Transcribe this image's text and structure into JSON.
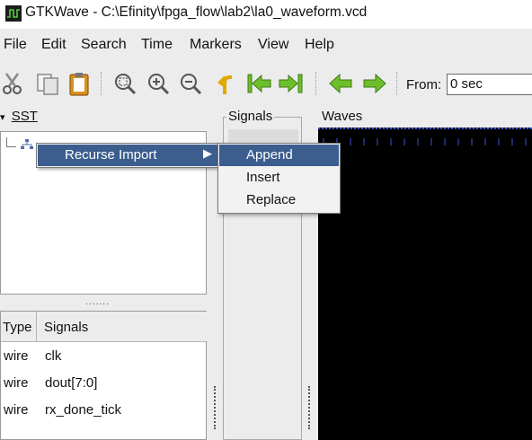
{
  "window": {
    "title": "GTKWave - C:\\Efinity\\fpga_flow\\lab2\\la0_waveform.vcd",
    "icon": "gtkwave-app-icon"
  },
  "menubar": {
    "items": [
      {
        "label": "File"
      },
      {
        "label": "Edit"
      },
      {
        "label": "Search"
      },
      {
        "label": "Time"
      },
      {
        "label": "Markers"
      },
      {
        "label": "View"
      },
      {
        "label": "Help"
      }
    ]
  },
  "toolbar": {
    "icons": [
      "cut-icon",
      "copy-icon",
      "paste-icon",
      "zoom-fit-icon",
      "zoom-in-icon",
      "zoom-out-icon",
      "undo-icon",
      "jump-to-start-icon",
      "jump-to-end-icon",
      "previous-edge-icon",
      "next-edge-icon"
    ],
    "from_label": "From:",
    "from_value": "0 sec"
  },
  "sst": {
    "title": "SST",
    "collapse_glyph": "▾",
    "handle": "......."
  },
  "signals_table": {
    "headers": {
      "type": "Type",
      "signals": "Signals"
    },
    "rows": [
      {
        "type": "wire",
        "name": "clk"
      },
      {
        "type": "wire",
        "name": "dout[7:0]"
      },
      {
        "type": "wire",
        "name": "rx_done_tick"
      }
    ]
  },
  "signals_frame": {
    "title": "Signals"
  },
  "waves_frame": {
    "title": "Waves"
  },
  "context_menu": {
    "item": "Recurse Import",
    "arrow": "▶",
    "submenu": [
      "Append",
      "Insert",
      "Replace"
    ]
  },
  "colors": {
    "highlight": "#3c5e8f",
    "waves_background": "#000000",
    "arrow_green": "#6dbf2a",
    "paste_orange": "#d9901f"
  }
}
